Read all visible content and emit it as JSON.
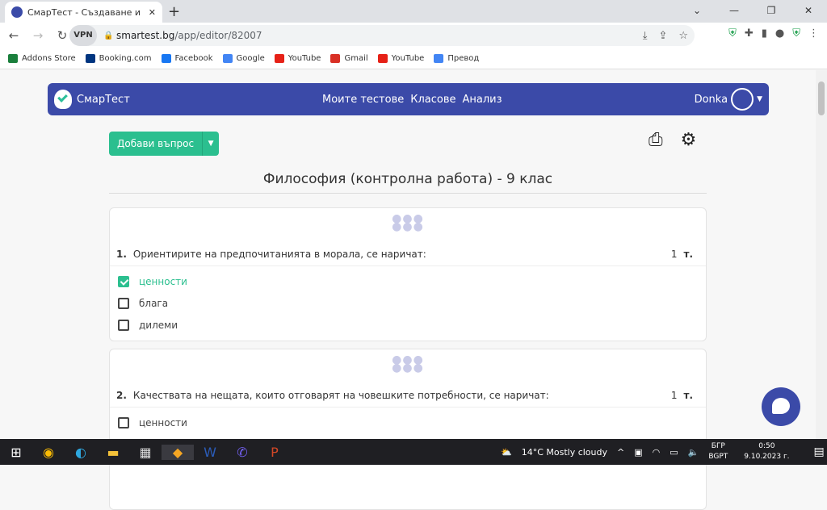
{
  "browser": {
    "tab_title": "СмарТест - Създаване и решаване",
    "url_domain": "smartest.bg",
    "url_path": "/app/editor/82007",
    "vpn": "VPN"
  },
  "bookmarks": [
    {
      "label": "Addons Store",
      "color": "#1a7f3c"
    },
    {
      "label": "Booking.com",
      "color": "#003580"
    },
    {
      "label": "Facebook",
      "color": "#1877f2"
    },
    {
      "label": "Google",
      "color": "#4285f4"
    },
    {
      "label": "YouTube",
      "color": "#e62117"
    },
    {
      "label": "Gmail",
      "color": "#d93025"
    },
    {
      "label": "YouTube",
      "color": "#e62117"
    },
    {
      "label": "Превод",
      "color": "#4285f4"
    }
  ],
  "app": {
    "brand": "СмарТест",
    "menu": [
      "Моите тестове",
      "Класове",
      "Анализ"
    ],
    "user": "Donka",
    "add_question": "Добави въпрос",
    "test_title": "Философия (контролна работа) - 9 клас",
    "accent": "#2bbf8f",
    "header_color": "#3b4aa8"
  },
  "questions": [
    {
      "num": "1.",
      "text": "Ориентирите на предпочитанията в морала, се наричат:",
      "points": "1",
      "points_unit": "т.",
      "options": [
        {
          "label": "ценности",
          "checked": true
        },
        {
          "label": "блага",
          "checked": false
        },
        {
          "label": "дилеми",
          "checked": false
        }
      ]
    },
    {
      "num": "2.",
      "text": "Качествата на нещата, които отговарят на човешките потребности, се наричат:",
      "points": "1",
      "points_unit": "т.",
      "options": [
        {
          "label": "ценности",
          "checked": false
        }
      ]
    }
  ],
  "taskbar": {
    "weather": "14°C  Mostly cloudy",
    "lang1": "БГР",
    "lang2": "BGPT",
    "time": "0:50",
    "date": "9.10.2023 г."
  }
}
